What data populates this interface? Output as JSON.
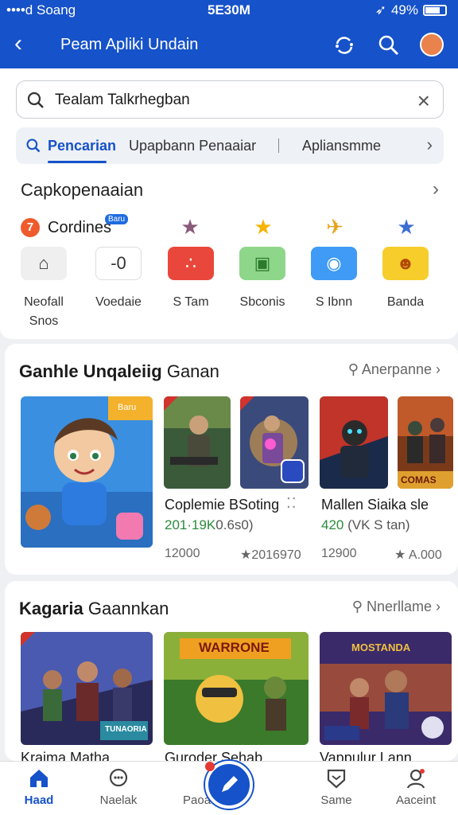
{
  "status_bar": {
    "carrier": "••••d Soang",
    "time": "5E30M",
    "battery_text": "49%"
  },
  "app_bar": {
    "title": "Peam Apliki Undain"
  },
  "search": {
    "query": "Tealam Talkrhegban"
  },
  "tabs": [
    {
      "label": "Pencarian",
      "active": true
    },
    {
      "label": "Upapbann Penaaiar",
      "active": false
    },
    {
      "label": "Apliansmme",
      "active": false
    }
  ],
  "categories": {
    "heading": "Capkopenaaian",
    "count": "7",
    "name": "Cordines",
    "badge": "Baru",
    "icons": [
      "star-icon-purple",
      "star-icon-gold",
      "plane-icon",
      "star-icon-blue"
    ],
    "items": [
      {
        "label": "Neofall\nSnos",
        "glyph": "⌂",
        "bg": "#efefef",
        "fg": "#333333"
      },
      {
        "label": "Voedaie",
        "glyph": "-0",
        "bg": "#ffffff",
        "fg": "#333333"
      },
      {
        "label": "S Tam",
        "glyph": "∴",
        "bg": "#e9473b",
        "fg": "#ffffff"
      },
      {
        "label": "Sbconis",
        "glyph": "▣",
        "bg": "#8ed68a",
        "fg": "#2c7a2c"
      },
      {
        "label": "S Ibnn",
        "glyph": "◉",
        "bg": "#3f9bf5",
        "fg": "#ffffff"
      },
      {
        "label": "Banda",
        "glyph": "☻",
        "bg": "#f6cd2a",
        "fg": "#b24a00"
      }
    ]
  },
  "section1": {
    "title_bold": "Ganhle Unqaleiig",
    "title_rest": "Ganan",
    "see_more": "Anerpanne",
    "featured_badge": "Baru",
    "games": [
      {
        "name": "Coplemie BSoting",
        "sub_green": "201·19K",
        "sub_rest": "0.6s0)",
        "downloads": "12000",
        "rating": "★2016970"
      },
      {
        "name": "Mallen Siaika sle",
        "sub_green": "420",
        "sub_rest": "(VK S tan)",
        "downloads": "12900",
        "rating": "★ A.000"
      }
    ],
    "poster_caption": "COMAS"
  },
  "section2": {
    "title_bold": "Kagaria",
    "title_rest": "Gaannkan",
    "see_more": "Nnerllame",
    "games": [
      {
        "name": "Kraima Matha",
        "poster_title": "TUNAORIA"
      },
      {
        "name": "Guroder Sehab",
        "poster_title": "WARRONE"
      },
      {
        "name": "Vappulur Lann",
        "poster_title": "MOSTANDA"
      }
    ]
  },
  "bottom_nav": [
    {
      "label": "Haad",
      "active": true
    },
    {
      "label": "Naelak",
      "active": false
    },
    {
      "label": "Paoa",
      "active": false
    },
    {
      "label": "Same",
      "active": false
    },
    {
      "label": "Aaceint",
      "active": false
    }
  ],
  "colors": {
    "primary": "#1652c9",
    "accent_green": "#2a8a3a",
    "badge_orange": "#ef5b2c"
  }
}
